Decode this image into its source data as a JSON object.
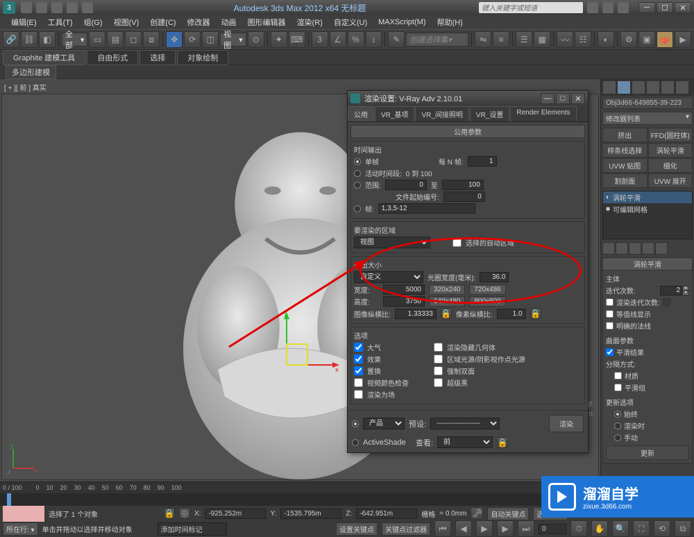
{
  "titlebar": {
    "app_title": "Autodesk 3ds Max 2012 x64   无标题",
    "search_placeholder": "键入关键字或短语"
  },
  "menu": {
    "edit": "编辑(E)",
    "tools": "工具(T)",
    "group": "组(G)",
    "views": "视图(V)",
    "create": "创建(C)",
    "modifiers": "修改器",
    "animation": "动画",
    "grapheditor": "图形编辑器",
    "rendering": "渲染(R)",
    "customize": "自定义(U)",
    "maxscript": "MAXScript(M)",
    "help": "帮助(H)"
  },
  "toolbar": {
    "select_combo": "全部",
    "view_combo": "视图",
    "selectionset_combo": "创建选择集"
  },
  "ribbon": {
    "graphite": "Graphite 建模工具",
    "freeform": "自由形式",
    "select": "选择",
    "objectpaint": "对象绘制",
    "polymodel": "多边形建模"
  },
  "viewport": {
    "label": "[ + ][ 前 ] 真实"
  },
  "cmdpanel": {
    "obj_name": "Obj3d66-649855-39-223",
    "modlist": "修改器列表",
    "btn_extrude": "挤出",
    "btn_ffd": "FFD(圆柱体)",
    "btn_splineSel": "样条线选择",
    "btn_turbo": "涡轮平滑",
    "btn_uvwmap": "UVW 贴图",
    "btn_tessellate": "细化",
    "btn_sliceplane": "割剖面",
    "btn_uvwunwrap": "UVW 展开",
    "stack_turbo": "涡轮平滑",
    "stack_editmesh": "可编辑网格",
    "rollout_turbo": "涡轮平滑",
    "grp_main": "主体",
    "iter_label": "迭代次数:",
    "iter_val": "2",
    "renderiter_label": "渲染迭代次数:",
    "renderiter_val": "",
    "isoline": "等值线显示",
    "explicit": "明确的法线",
    "grp_surface": "曲面参数",
    "smoothresult": "平滑结果",
    "septype": "分隔方式:",
    "sep_mat": "材质",
    "sep_smooth": "平滑组",
    "grp_update": "更新选项",
    "upd_always": "始终",
    "upd_render": "渲染时",
    "upd_manual": "手动",
    "update_btn": "更新"
  },
  "dialog": {
    "title": "渲染设置: V-Ray Adv 2.10.01",
    "tab_common": "公用",
    "tab_vrbase": "VR_基项",
    "tab_vrgi": "VR_间接照明",
    "tab_vrset": "VR_设置",
    "tab_elements": "Render Elements",
    "rollout_common": "公用参数",
    "grp_time": "时间输出",
    "time_single": "单帧",
    "everyNframe": "每 N 帧:",
    "everyN_val": "1",
    "time_active": "活动时间段:",
    "time_active_range": "0 到 100",
    "time_range": "范围:",
    "range_from": "0",
    "range_to_lbl": "至",
    "range_to": "100",
    "filenum_label": "文件起始编号:",
    "filenum_val": "0",
    "time_frames": "帧:",
    "frames_val": "1,3,5-12",
    "grp_area": "要渲染的区域",
    "area_combo": "视图",
    "area_autoregion": "选择的自动区域",
    "grp_outsize": "输出大小",
    "outsize_combo": "自定义",
    "aperture_label": "光圈宽度(毫米):",
    "aperture_val": "36.0",
    "width_label": "宽度:",
    "width_val": "5000",
    "preset1": "320x240",
    "preset2": "720x486",
    "height_label": "高度:",
    "height_val": "3750",
    "preset3": "640x480",
    "preset4": "800x600",
    "imgaspect_label": "图像纵横比:",
    "imgaspect_val": "1.33333",
    "pixaspect_label": "像素纵横比:",
    "pixaspect_val": "1.0",
    "grp_options": "选项",
    "opt_atmos": "大气",
    "opt_hidegeo": "渲染隐藏几何体",
    "opt_effects": "效果",
    "opt_arealight": "区域光源/阴影视作点光源",
    "opt_disp": "置换",
    "opt_2side": "强制双面",
    "opt_vidcolor": "视频颜色检查",
    "opt_superblack": "超级黑",
    "opt_renderfield": "渲染为场",
    "footer_production": "产品",
    "footer_activeshade": "ActiveShade",
    "footer_preset_lbl": "预设:",
    "footer_view_lbl": "查看:",
    "footer_view_val": "前",
    "footer_render": "渲染"
  },
  "status": {
    "frame_range": "0 / 100",
    "selected": "选择了 1 个对象",
    "hint": "单击并拖动以选择并移动对象",
    "x_label": "X:",
    "x_val": "-925.252m",
    "y_label": "Y:",
    "y_val": "-1535.795m",
    "z_label": "Z:",
    "z_val": "-642.951m",
    "grid_label": "栅格",
    "grid_val": "= 0.0mm",
    "autokey": "自动关键点",
    "selset": "选定对象",
    "setkey": "设置关键点",
    "keyfilter": "关键点过滤器",
    "placein": "所在行:",
    "addmarker": "添加时间标记"
  },
  "watermark": {
    "line1": "溜溜自学",
    "line2": "www.3d66.com"
  },
  "brand": {
    "big": "溜溜自学",
    "small": "zixue.3d66.com"
  }
}
